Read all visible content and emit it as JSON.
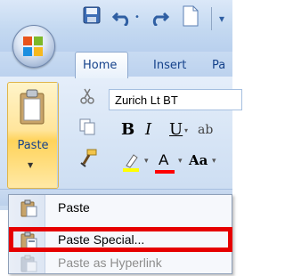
{
  "tabs": {
    "home": "Home",
    "insert": "Insert",
    "page_layout_partial": "Pa"
  },
  "ribbon": {
    "paste_label": "Paste",
    "font_name": "Zurich Lt BT",
    "bold": "B",
    "italic": "I",
    "underline": "U",
    "font_color_glyph": "A",
    "change_case_glyph": "Aa"
  },
  "paste_menu": {
    "items": [
      {
        "label": "Paste",
        "enabled": true,
        "icon": "paste-icon"
      },
      {
        "label": "Paste Special...",
        "enabled": true,
        "icon": "paste-special-icon",
        "highlighted": true
      },
      {
        "label": "Paste as Hyperlink",
        "enabled": false,
        "icon": "paste-hyperlink-icon"
      }
    ]
  },
  "colors": {
    "highlight_red": "#e60000",
    "tab_text": "#15428b",
    "highlighter_yellow": "#ffff00",
    "font_color_red": "#ff0000"
  }
}
